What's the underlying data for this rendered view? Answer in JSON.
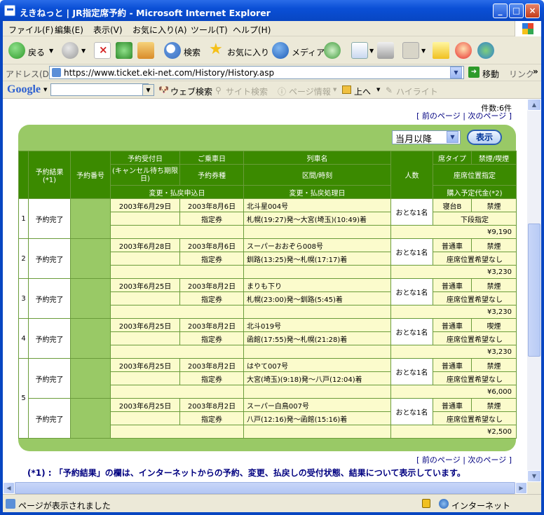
{
  "window": {
    "title": "えきねっと | JR指定席予約 - Microsoft Internet Explorer",
    "minimize": "_",
    "maximize": "□",
    "close": "×"
  },
  "menu": [
    "ファイル(F)",
    "編集(E)",
    "表示(V)",
    "お気に入り(A)",
    "ツール(T)",
    "ヘルプ(H)"
  ],
  "toolbar": {
    "back": "戻る",
    "search": "検索",
    "favorites": "お気に入り",
    "media": "メディア"
  },
  "address": {
    "label": "アドレス(D)",
    "url": "https://www.ticket.eki-net.com/History/History.asp",
    "go": "移動",
    "links": "リンク"
  },
  "google": {
    "logo": "Google",
    "web_search": "ウェブ検索",
    "site_search": "サイト検索",
    "page_info": "ページ情報",
    "up": "上へ",
    "highlight": "ハイライト"
  },
  "page": {
    "count": "件数:6件",
    "nav_open": "[ ",
    "prev": "前のページ",
    "sep": " | ",
    "next": "次のページ",
    "nav_close": " ]",
    "period_select": "当月以降",
    "show_button": "表示",
    "headers": {
      "result": "予約結果 (*1)",
      "number": "予約番号",
      "reserved_date": "予約受付日",
      "ride_date": "ご乗車日",
      "train_name": "列車名",
      "passengers": "人数",
      "seat_type": "席タイプ",
      "smoking": "禁煙/喫煙",
      "cancel_deadline": "(キャンセル待ち期限日)",
      "ticket_type": "予約券種",
      "section_time": "区間/時刻",
      "seat_position": "座席位置指定",
      "change_request_date": "変更・払戻申込日",
      "change_process_date": "変更・払戻処理日",
      "price": "購入予定代金(*2)"
    },
    "rows": [
      {
        "no": "1",
        "groups": [
          {
            "result": "予約完了",
            "reserved": "2003年6月29日",
            "ride": "2003年8月6日",
            "train": "北斗星004号",
            "passengers": "おとな1名",
            "seat": "寝台B",
            "smoking": "禁煙",
            "ticket": "指定券",
            "route": "札幌(19:27)発～大宮(埼玉)(10:49)着",
            "position": "下段指定",
            "price": "¥9,190"
          }
        ]
      },
      {
        "no": "2",
        "groups": [
          {
            "result": "予約完了",
            "reserved": "2003年6月28日",
            "ride": "2003年8月6日",
            "train": "スーパーおおぞら008号",
            "passengers": "おとな1名",
            "seat": "普通車",
            "smoking": "禁煙",
            "ticket": "指定券",
            "route": "釧路(13:25)発～札幌(17:17)着",
            "position": "座席位置希望なし",
            "price": "¥3,230"
          }
        ]
      },
      {
        "no": "3",
        "groups": [
          {
            "result": "予約完了",
            "reserved": "2003年6月25日",
            "ride": "2003年8月2日",
            "train": "まりも下り",
            "passengers": "おとな1名",
            "seat": "普通車",
            "smoking": "禁煙",
            "ticket": "指定券",
            "route": "札幌(23:00)発～釧路(5:45)着",
            "position": "座席位置希望なし",
            "price": "¥3,230"
          }
        ]
      },
      {
        "no": "4",
        "groups": [
          {
            "result": "予約完了",
            "reserved": "2003年6月25日",
            "ride": "2003年8月2日",
            "train": "北斗019号",
            "passengers": "おとな1名",
            "seat": "普通車",
            "smoking": "喫煙",
            "ticket": "指定券",
            "route": "函館(17:55)発～札幌(21:28)着",
            "position": "座席位置希望なし",
            "price": "¥3,230"
          }
        ]
      },
      {
        "no": "5",
        "groups": [
          {
            "result": "予約完了",
            "reserved": "2003年6月25日",
            "ride": "2003年8月2日",
            "train": "はやて007号",
            "passengers": "おとな1名",
            "seat": "普通車",
            "smoking": "禁煙",
            "ticket": "指定券",
            "route": "大宮(埼玉)(9:18)発～八戸(12:04)着",
            "position": "座席位置希望なし",
            "price": "¥6,000"
          },
          {
            "result": "予約完了",
            "reserved": "2003年6月25日",
            "ride": "2003年8月2日",
            "train": "スーパー白鳥007号",
            "passengers": "おとな1名",
            "seat": "普通車",
            "smoking": "禁煙",
            "ticket": "指定券",
            "route": "八戸(12:16)発～函館(15:16)着",
            "position": "座席位置希望なし",
            "price": "¥2,500"
          }
        ]
      }
    ],
    "footnote": "(*1) : 「予約結果」の欄は、インターネットからの予約、変更、払戻しの受付状態、結果について表示しています。"
  },
  "status": {
    "text": "ページが表示されました",
    "zone": "インターネット"
  }
}
